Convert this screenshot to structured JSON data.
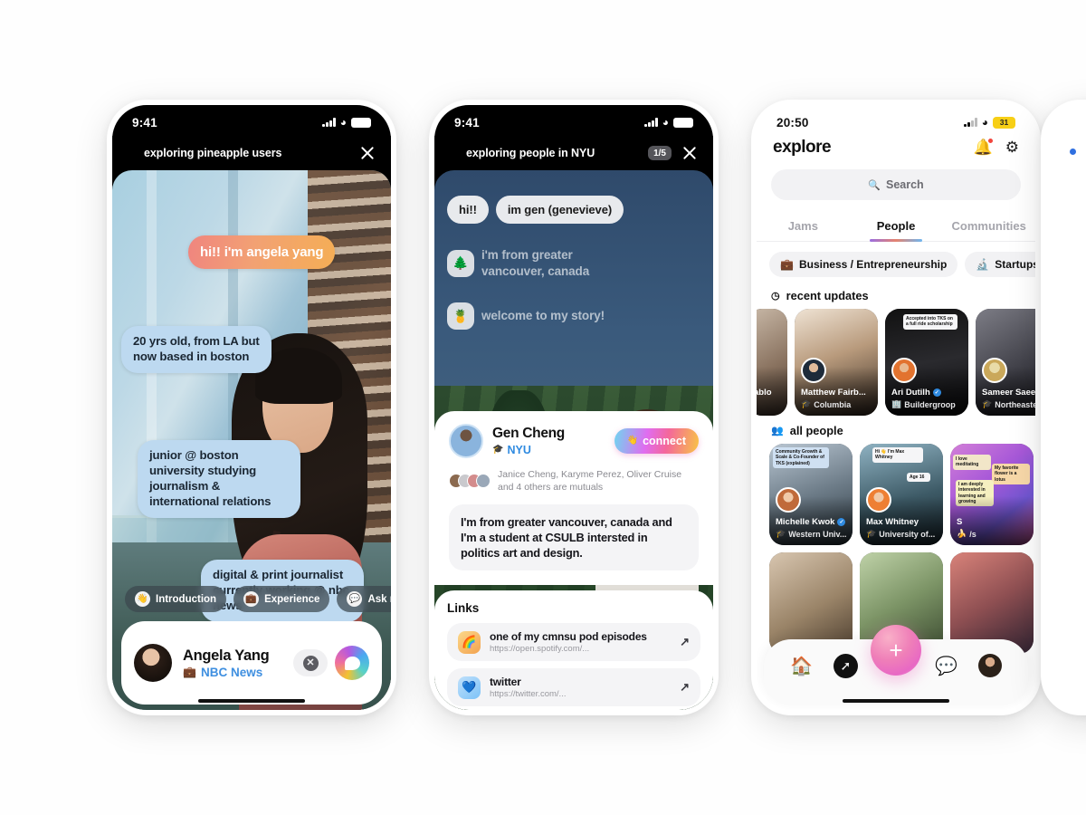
{
  "phone1": {
    "status": {
      "time": "9:41",
      "battery_icon": "battery-full"
    },
    "header": {
      "icon": "binoculars-icon",
      "title": "exploring pineapple users",
      "close": "close-icon"
    },
    "bubbles": [
      {
        "text": "hi!! i'm angela yang",
        "style": "gradient"
      },
      {
        "text": "20 yrs old, from LA but now based in boston",
        "style": "blue"
      },
      {
        "text": "junior @ boston university studying journalism & international relations",
        "style": "blue"
      },
      {
        "text": "digital & print journalist currently working @ nbc news",
        "style": "blue"
      }
    ],
    "chips": [
      {
        "emoji": "👋",
        "label": "Introduction"
      },
      {
        "emoji": "💼",
        "label": "Experience"
      },
      {
        "emoji": "💬",
        "label": "Ask me about"
      }
    ],
    "footer": {
      "name": "Angela Yang",
      "org_emoji": "💼",
      "org": "NBC News",
      "close_label": "✕",
      "message_icon": "message-bubble-icon"
    }
  },
  "phone2": {
    "status": {
      "time": "9:41"
    },
    "header": {
      "icon": "binoculars-icon",
      "title": "exploring people in NYU",
      "page": "1/5",
      "close": "close-icon"
    },
    "story_bubbles": [
      {
        "text": "hi!!"
      },
      {
        "text": "im gen (genevieve)"
      }
    ],
    "story_ghost": [
      {
        "emoji": "🌲",
        "text": "i'm from greater vancouver, canada"
      },
      {
        "emoji": "🍍",
        "text": "welcome to my story!"
      }
    ],
    "profile": {
      "name": "Gen Cheng",
      "school_emoji": "🎓",
      "school": "NYU",
      "connect_label": "connect",
      "connect_emoji": "👋",
      "mutuals": "Janice Cheng, Karyme Perez, Oliver Cruise and 4 others are mutuals",
      "bio": "I'm from greater vancouver, canada and I'm a student at CSULB intersted in politics art and design."
    },
    "links": {
      "title": "Links",
      "items": [
        {
          "emoji": "🌈",
          "title": "one of my cmnsu pod episodes",
          "url": "https://open.spotify.com/..."
        },
        {
          "emoji": "💙",
          "title": "twitter",
          "url": "https://twitter.com/..."
        }
      ]
    }
  },
  "phone3": {
    "status": {
      "time": "20:50",
      "battery": "31"
    },
    "title": "explore",
    "icons": {
      "bell": "bell-icon",
      "gear": "gear-icon"
    },
    "search_placeholder": "Search",
    "tabs": [
      {
        "label": "Jams",
        "active": false
      },
      {
        "label": "People",
        "active": true
      },
      {
        "label": "Communities",
        "active": false
      }
    ],
    "filters": [
      {
        "emoji": "💼",
        "label": "Business / Entrepreneurship"
      },
      {
        "emoji": "🔬",
        "label": "Startups"
      }
    ],
    "sections": [
      {
        "emoji": "🕘",
        "label": "recent updates"
      },
      {
        "emoji": "👥",
        "label": "all people"
      }
    ],
    "recent_updates": [
      {
        "name": "ablo",
        "school": "",
        "verified": false,
        "cut": true
      },
      {
        "name": "Matthew Fairb...",
        "school_emoji": "🎓",
        "school": "Columbia",
        "verified": false
      },
      {
        "name": "Ari Dutilh",
        "school_emoji": "🏢",
        "school": "Buildergroop",
        "verified": true,
        "note": "Accepted into TKS on a full ride scholarship"
      },
      {
        "name": "Sameer Saeed",
        "school_emoji": "🎓",
        "school": "Northeastern",
        "verified": false
      }
    ],
    "all_people": [
      {
        "name": "Michelle Kwok",
        "school_emoji": "🎓",
        "school": "Western Univ...",
        "verified": true,
        "note": "Community Growth & Scale & Co-Founder of TKS (explained)"
      },
      {
        "name": "Max Whitney",
        "school_emoji": "🎓",
        "school": "University of...",
        "verified": false,
        "note": "Hi 👋 I'm Max Whitney",
        "note2": "Age 16"
      },
      {
        "name": "S",
        "school_emoji": "🍌",
        "school": "/s",
        "verified": false,
        "note": "I love meditating",
        "note2": "My favorite flower is a lotus",
        "note3": "I am deeply interested in learning and growing"
      }
    ],
    "nav": [
      {
        "icon": "home-icon",
        "active": false
      },
      {
        "icon": "compass-icon",
        "active": true
      },
      {
        "icon": "plus-icon",
        "active": false,
        "fab": true
      },
      {
        "icon": "chat-icon",
        "active": false
      },
      {
        "icon": "profile-avatar",
        "active": false
      }
    ]
  }
}
